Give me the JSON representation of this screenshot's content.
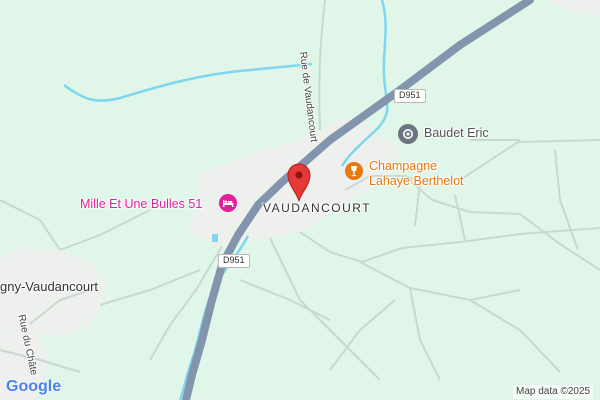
{
  "map": {
    "place_labels": {
      "village": "VAUDANCOURT",
      "town_partial": "gny-Vaudancourt"
    },
    "street_labels": {
      "rue_vaudancourt": "Rue de Vaudancourt",
      "rue_chateau": "Rue du Châte"
    },
    "road_shields": {
      "upper": "D951",
      "lower": "D951"
    },
    "pois": {
      "hotel": {
        "name": "Mille Et Une Bulles 51",
        "icon": "bed-icon",
        "color": "#e0219b"
      },
      "winery": {
        "name_line1": "Champagne",
        "name_line2": "Lahaye Berthelot",
        "icon": "wine-glass-icon",
        "color": "#e8790f"
      },
      "place": {
        "name": "Baudet Eric",
        "icon": "pin-icon",
        "color": "#6b7480"
      }
    },
    "marker": {
      "icon": "map-pin-icon",
      "color": "#e53935"
    },
    "attribution": "Map data ©2025",
    "logo": "Google",
    "colors": {
      "background": "#dff6e8",
      "road_main": "#8395ad",
      "water": "#7fd6ee",
      "built_area": "#eef0ee",
      "minor_road": "#c9d7cf"
    }
  }
}
